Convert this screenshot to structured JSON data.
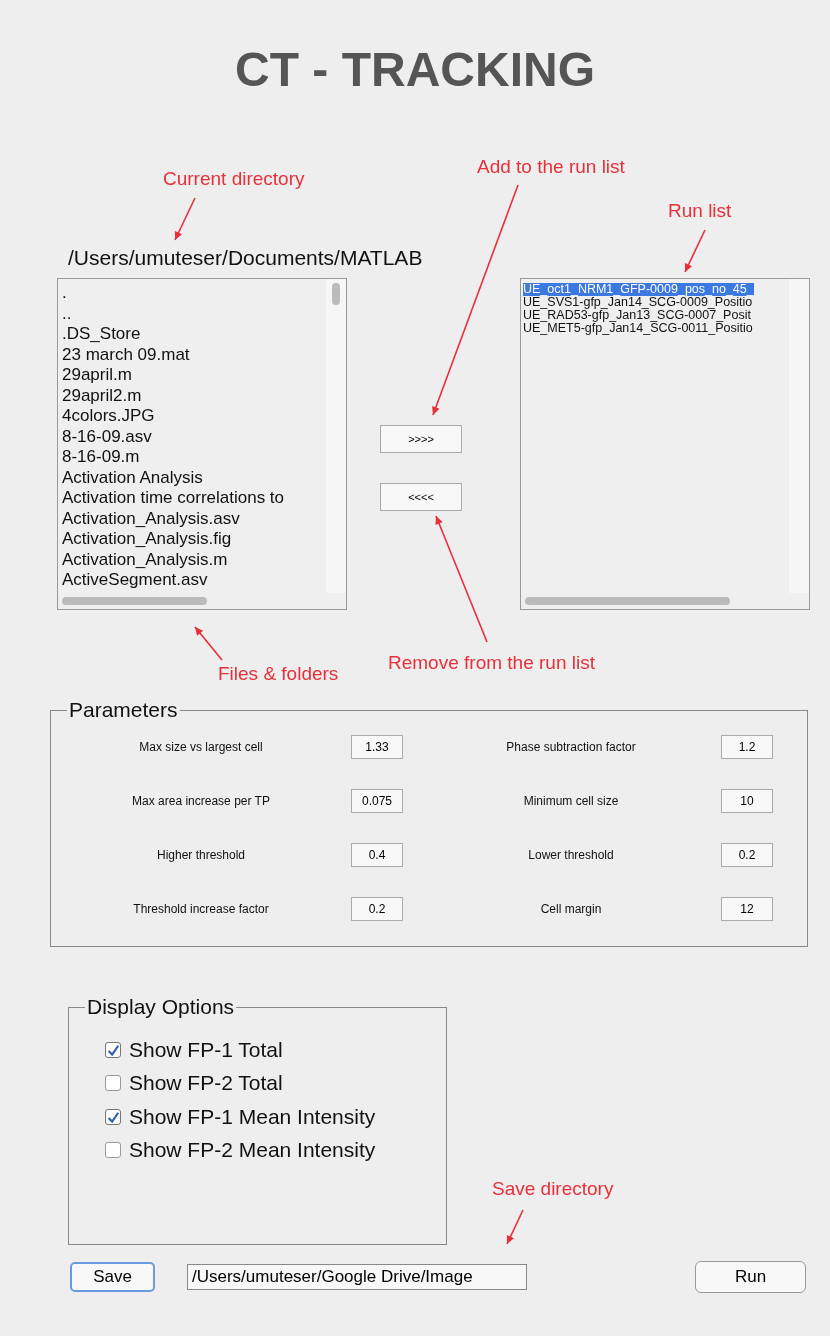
{
  "title": "CT - TRACKING",
  "current_directory": "/Users/umuteser/Documents/MATLAB",
  "files": [
    ".",
    "..",
    ".DS_Store",
    "23 march 09.mat",
    "29april.m",
    "29april2.m",
    "4colors.JPG",
    "8-16-09.asv",
    "8-16-09.m",
    "Activation Analysis",
    "Activation time correlations to",
    "Activation_Analysis.asv",
    "Activation_Analysis.fig",
    "Activation_Analysis.m",
    "ActiveSegment.asv"
  ],
  "add_button": ">>>>",
  "remove_button": "<<<<",
  "run_list": [
    {
      "label": "UE_oct1_NRM1_GFP-0009_pos_no_45_",
      "selected": true
    },
    {
      "label": "UE_SVS1-gfp_Jan14_SCG-0009_Positio",
      "selected": false
    },
    {
      "label": "UE_RAD53-gfp_Jan13_SCG-0007_Posit",
      "selected": false
    },
    {
      "label": "UE_MET5-gfp_Jan14_SCG-0011_Positio",
      "selected": false
    }
  ],
  "parameters": {
    "title": "Parameters",
    "items": [
      {
        "label": "Max size vs largest cell",
        "value": "1.33"
      },
      {
        "label": "Phase subtraction factor",
        "value": "1.2"
      },
      {
        "label": "Max area increase per TP",
        "value": "0.075"
      },
      {
        "label": "Minimum cell size",
        "value": "10"
      },
      {
        "label": "Higher threshold",
        "value": "0.4"
      },
      {
        "label": "Lower threshold",
        "value": "0.2"
      },
      {
        "label": "Threshold increase factor",
        "value": "0.2"
      },
      {
        "label": "Cell margin",
        "value": "12"
      }
    ]
  },
  "display_options": {
    "title": "Display Options",
    "items": [
      {
        "label": "Show FP-1 Total",
        "checked": true
      },
      {
        "label": "Show FP-2 Total",
        "checked": false
      },
      {
        "label": "Show FP-1 Mean Intensity",
        "checked": true
      },
      {
        "label": "Show FP-2 Mean Intensity",
        "checked": false
      }
    ]
  },
  "save_button": "Save",
  "save_directory": "/Users/umuteser/Google Drive/Image",
  "run_button": "Run",
  "annotations": [
    "Current directory",
    "Add to the run list",
    "Run list",
    "Files & folders",
    "Remove from the run list",
    "Save directory"
  ]
}
